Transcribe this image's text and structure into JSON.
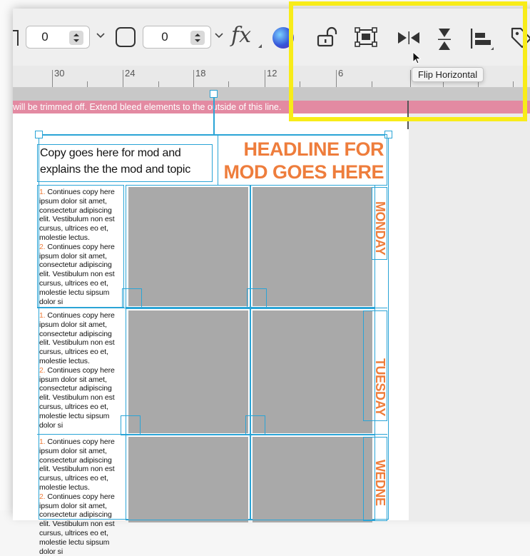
{
  "toolbar": {
    "field1_value": "0",
    "field2_value": "0",
    "fx_label": "fx",
    "icons": [
      "stepper-icon",
      "chevron-down-icon",
      "rounded-square-icon",
      "fx-icon",
      "color-circle-icon",
      "unlock-icon",
      "group-frame-icon",
      "flip-horizontal-icon",
      "flip-vertical-icon",
      "align-left-icon",
      "tag-icon"
    ]
  },
  "tooltip": {
    "text": "Flip Horizontal"
  },
  "ruler": {
    "labels": [
      "30",
      "24",
      "18",
      "12",
      "6"
    ]
  },
  "bleed_banner": {
    "text": "will be trimmed off. Extend bleed elements to the outside of this line."
  },
  "layout_content": {
    "intro_copy": "Copy goes here for mod and explains the the mod and topic",
    "headline_line1": "HEADLINE FOR",
    "headline_line2": "MOD GOES HERE",
    "days": [
      "MONDAY",
      "TUESDAY",
      "WEDNE"
    ],
    "column_items": {
      "n1": "1.",
      "n2": "2.",
      "item1": " Continues copy here ipsum dolor sit amet, consectetur adipiscing elit. Vestibulum non est cursus, ultrices eo et, molestie lectus.",
      "item2": " Continues copy here ipsum dolor sit amet, consectetur adipiscing elit. Vestibulum non est cursus, ultrices eo et, molestie lectu sipsum dolor si"
    }
  },
  "colors": {
    "accent_orange": "#ee7d3c",
    "frame_blue": "#2aa4d6",
    "highlight_yellow": "#f8ec19",
    "bleed_pink": "#e38aa2"
  }
}
